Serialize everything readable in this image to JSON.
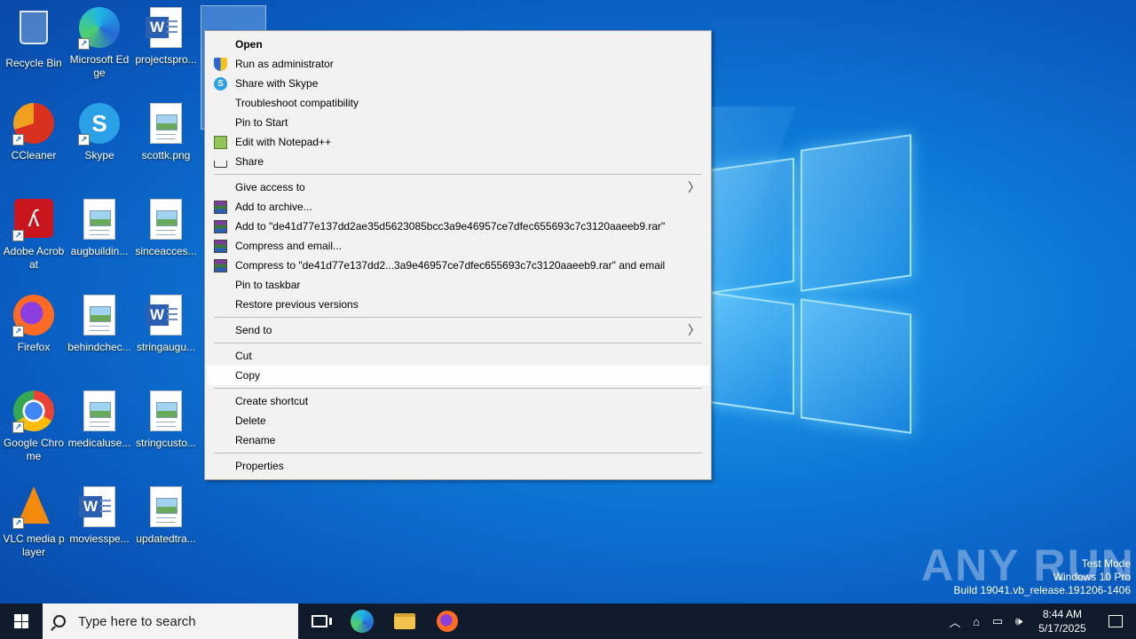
{
  "desktop": {
    "icons": [
      {
        "label": "Recycle Bin",
        "icon": "recycle-bin-icon"
      },
      {
        "label": "Microsoft Edge",
        "icon": "edge-icon"
      },
      {
        "label": "projectspro...",
        "icon": "word-doc-icon"
      },
      {
        "label": "CCleaner",
        "icon": "ccleaner-icon"
      },
      {
        "label": "Skype",
        "icon": "skype-icon"
      },
      {
        "label": "scottk.png",
        "icon": "image-file-icon"
      },
      {
        "label": "Adobe Acrobat",
        "icon": "acrobat-icon"
      },
      {
        "label": "augbuildin...",
        "icon": "image-file-icon"
      },
      {
        "label": "sinceacces...",
        "icon": "image-file-icon"
      },
      {
        "label": "Firefox",
        "icon": "firefox-icon"
      },
      {
        "label": "behindchec...",
        "icon": "image-file-icon"
      },
      {
        "label": "stringaugu...",
        "icon": "word-doc-icon"
      },
      {
        "label": "Google Chrome",
        "icon": "chrome-icon"
      },
      {
        "label": "medicaluse...",
        "icon": "image-file-icon"
      },
      {
        "label": "stringcusto...",
        "icon": "image-file-icon"
      },
      {
        "label": "VLC media player",
        "icon": "vlc-icon"
      },
      {
        "label": "moviesspe...",
        "icon": "word-doc-icon"
      },
      {
        "label": "updatedtra...",
        "icon": "image-file-icon"
      }
    ]
  },
  "context_menu": {
    "open": "Open",
    "run_as_admin": "Run as administrator",
    "share_skype": "Share with Skype",
    "troubleshoot": "Troubleshoot compatibility",
    "pin_start": "Pin to Start",
    "edit_npp": "Edit with Notepad++",
    "share": "Share",
    "give_access": "Give access to",
    "add_archive": "Add to archive...",
    "add_to_rar": "Add to \"de41d77e137dd2ae35d5623085bcc3a9e46957ce7dfec655693c7c3120aaeeb9.rar\"",
    "compress_email": "Compress and email...",
    "compress_to_rar_email": "Compress to \"de41d77e137dd2...3a9e46957ce7dfec655693c7c3120aaeeb9.rar\" and email",
    "pin_taskbar": "Pin to taskbar",
    "restore_prev": "Restore previous versions",
    "send_to": "Send to",
    "cut": "Cut",
    "copy": "Copy",
    "create_shortcut": "Create shortcut",
    "delete": "Delete",
    "rename": "Rename",
    "properties": "Properties",
    "submenu_arrow": "〉"
  },
  "taskbar": {
    "search_placeholder": "Type here to search",
    "time": "8:44 AM",
    "date": "5/17/2025"
  },
  "watermark": {
    "brand": "ANY RUN",
    "line1": "Test Mode",
    "line2": "Windows 10 Pro",
    "line3": "Build 19041.vb_release.191206-1406"
  },
  "colors": {
    "desktop_blue": "#0a5cc0",
    "menu_bg": "#f2f2f2",
    "taskbar_bg": "#0f1a2a"
  }
}
